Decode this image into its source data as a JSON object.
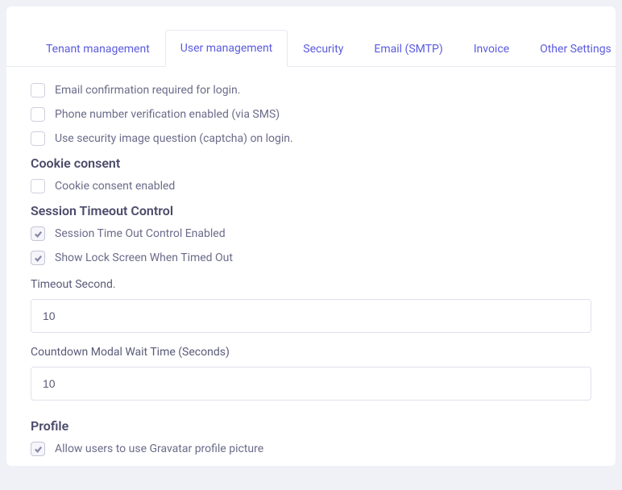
{
  "tabs": {
    "tenant": "Tenant management",
    "user": "User management",
    "security": "Security",
    "email": "Email (SMTP)",
    "invoice": "Invoice",
    "other": "Other Settings"
  },
  "checkboxes": {
    "email_confirm": "Email confirmation required for login.",
    "phone_verify": "Phone number verification enabled (via SMS)",
    "captcha": "Use security image question (captcha) on login.",
    "cookie_consent": "Cookie consent enabled",
    "session_timeout": "Session Time Out Control Enabled",
    "lock_screen": "Show Lock Screen When Timed Out",
    "gravatar": "Allow users to use Gravatar profile picture"
  },
  "headings": {
    "cookie": "Cookie consent",
    "session": "Session Timeout Control",
    "profile": "Profile"
  },
  "fields": {
    "timeout_label": "Timeout Second.",
    "timeout_value": "10",
    "countdown_label": "Countdown Modal Wait Time (Seconds)",
    "countdown_value": "10"
  }
}
